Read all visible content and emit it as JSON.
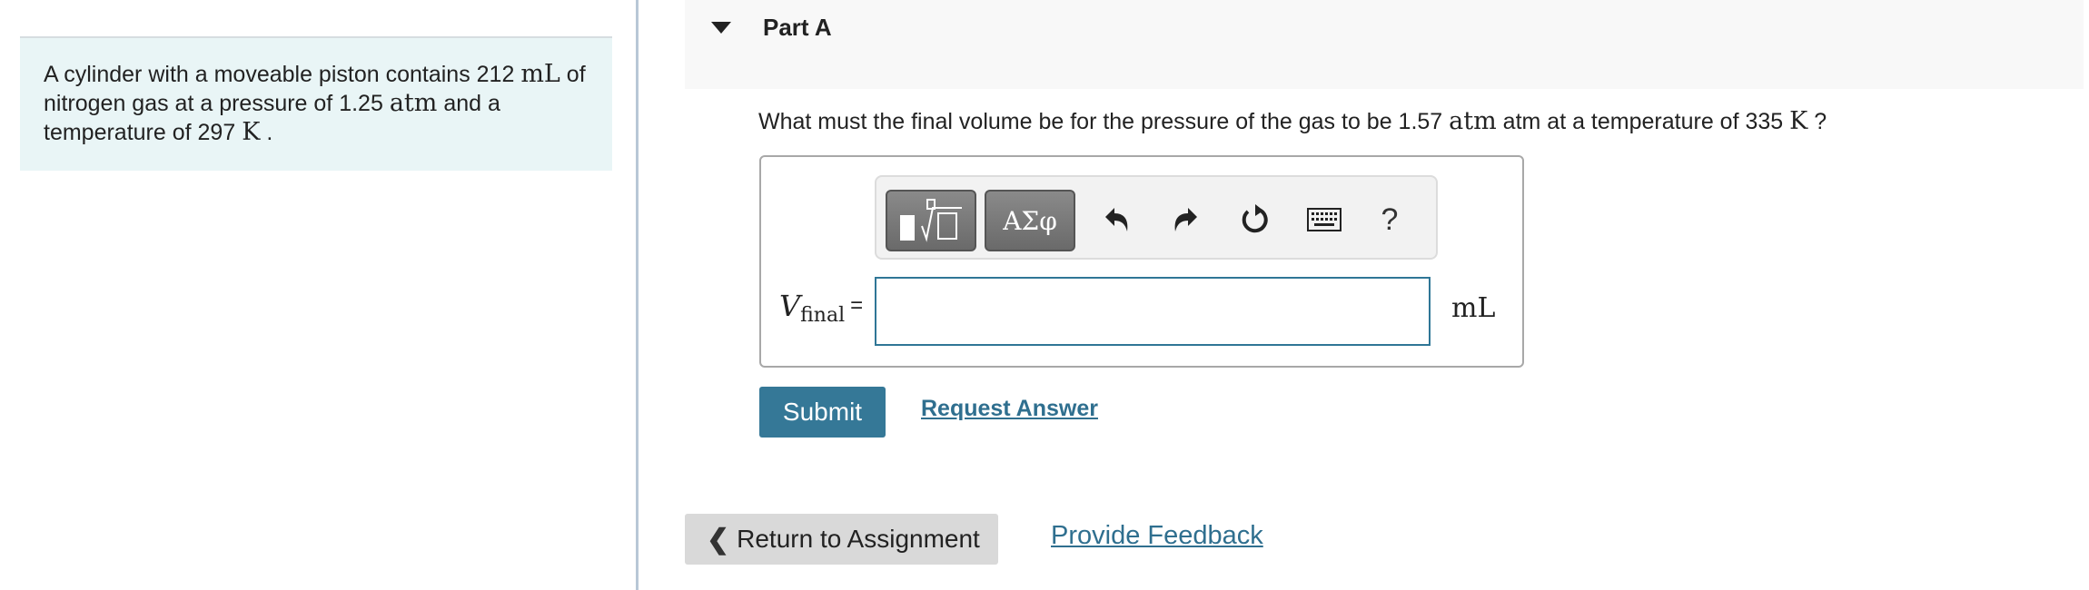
{
  "problem": {
    "text_1": "A cylinder with a moveable piston contains 212 ",
    "unit_1": "mL",
    "text_2": " of nitrogen gas at a pressure of 1.25 ",
    "unit_2": "atm",
    "text_3": " and a temperature of 297 ",
    "unit_3": "K",
    "text_4": " ."
  },
  "part": {
    "title": "Part A",
    "question_1": "What must the final volume be for the pressure of the gas to be 1.57 ",
    "question_unit_1": "atm",
    "question_2": " atm at a temperature of 335 ",
    "question_unit_2": "K",
    "question_3": " ?"
  },
  "toolbar": {
    "symbols_label": "ΑΣφ",
    "help_label": "?",
    "icons": [
      "templates-icon",
      "symbols-icon",
      "undo-icon",
      "redo-icon",
      "reset-icon",
      "keyboard-icon",
      "help-icon"
    ]
  },
  "answer": {
    "var_symbol": "V",
    "var_subscript": "final",
    "equals": "=",
    "value": "",
    "placeholder": "",
    "unit": "mL"
  },
  "actions": {
    "submit_label": "Submit",
    "request_answer_label": "Request Answer",
    "return_label": "Return to Assignment",
    "feedback_label": "Provide Feedback"
  },
  "colors": {
    "accent": "#357897",
    "link": "#2f6f8f",
    "problem_bg": "#e9f5f6"
  }
}
